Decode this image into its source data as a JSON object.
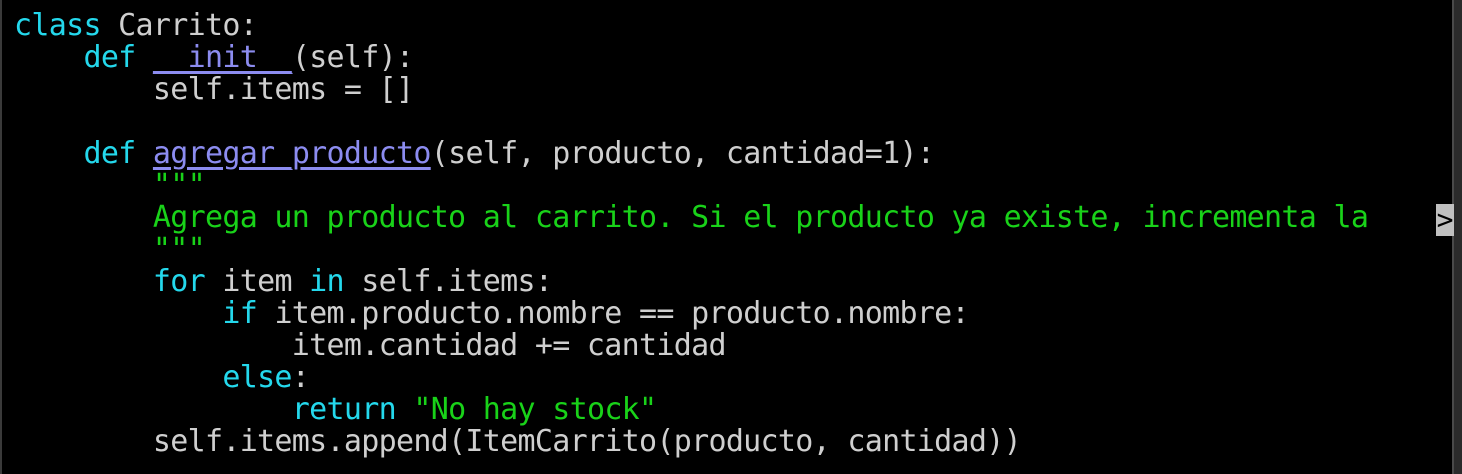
{
  "editor": {
    "lines": [
      {
        "tokens": [
          {
            "cls": "kw",
            "text": "class"
          },
          {
            "cls": "tx",
            "text": " Carrito:"
          }
        ]
      },
      {
        "tokens": [
          {
            "cls": "tx",
            "text": "    "
          },
          {
            "cls": "kw",
            "text": "def"
          },
          {
            "cls": "tx",
            "text": " "
          },
          {
            "cls": "fn",
            "text": "__init__"
          },
          {
            "cls": "tx",
            "text": "(self):"
          }
        ]
      },
      {
        "tokens": [
          {
            "cls": "tx",
            "text": "        self.items = []"
          }
        ]
      },
      {
        "tokens": [
          {
            "cls": "tx",
            "text": ""
          }
        ]
      },
      {
        "tokens": [
          {
            "cls": "tx",
            "text": "    "
          },
          {
            "cls": "kw",
            "text": "def"
          },
          {
            "cls": "tx",
            "text": " "
          },
          {
            "cls": "fn",
            "text": "agregar_producto"
          },
          {
            "cls": "tx",
            "text": "(self, producto, cantidad=1):"
          }
        ]
      },
      {
        "tokens": [
          {
            "cls": "tx",
            "text": "        "
          },
          {
            "cls": "doc",
            "text": "\"\"\""
          }
        ]
      },
      {
        "tokens": [
          {
            "cls": "tx",
            "text": "        "
          },
          {
            "cls": "doc",
            "text": "Agrega un producto al carrito. Si el producto ya existe, incrementa la"
          }
        ]
      },
      {
        "tokens": [
          {
            "cls": "tx",
            "text": "        "
          },
          {
            "cls": "doc",
            "text": "\"\"\""
          }
        ]
      },
      {
        "tokens": [
          {
            "cls": "tx",
            "text": "        "
          },
          {
            "cls": "kw",
            "text": "for"
          },
          {
            "cls": "tx",
            "text": " item "
          },
          {
            "cls": "kw",
            "text": "in"
          },
          {
            "cls": "tx",
            "text": " self.items:"
          }
        ]
      },
      {
        "tokens": [
          {
            "cls": "tx",
            "text": "            "
          },
          {
            "cls": "kw",
            "text": "if"
          },
          {
            "cls": "tx",
            "text": " item.producto.nombre == producto.nombre:"
          }
        ]
      },
      {
        "tokens": [
          {
            "cls": "tx",
            "text": "                item.cantidad += cantidad"
          }
        ]
      },
      {
        "tokens": [
          {
            "cls": "tx",
            "text": "            "
          },
          {
            "cls": "kw",
            "text": "else"
          },
          {
            "cls": "tx",
            "text": ":"
          }
        ]
      },
      {
        "tokens": [
          {
            "cls": "tx",
            "text": "                "
          },
          {
            "cls": "kw",
            "text": "return"
          },
          {
            "cls": "tx",
            "text": " "
          },
          {
            "cls": "str",
            "text": "\"No hay stock\""
          }
        ]
      },
      {
        "tokens": [
          {
            "cls": "tx",
            "text": "        self.items.append(ItemCarrito(producto, cantidad))"
          }
        ]
      }
    ],
    "overflow_marker": ">"
  },
  "colors": {
    "background": "#000000",
    "keyword": "#24d8ec",
    "function_name": "#8c8cf0",
    "text": "#cfcfcf",
    "docstring": "#19d219"
  }
}
